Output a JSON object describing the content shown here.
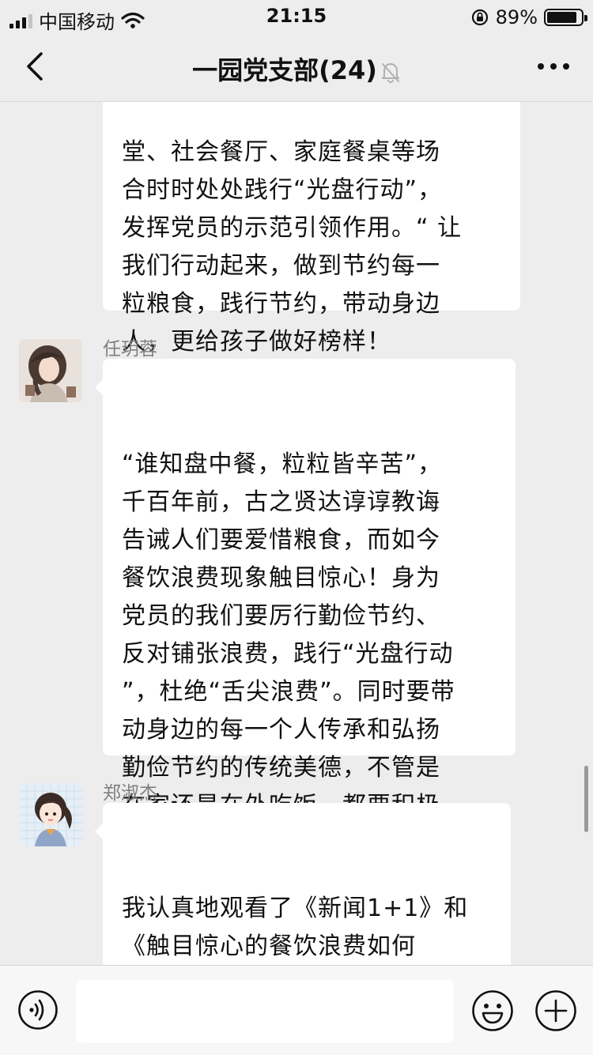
{
  "status_bar": {
    "carrier": "中国移动",
    "time": "21:15",
    "battery_percent_text": "89%",
    "battery_level": 0.89
  },
  "header": {
    "title": "一园党支部(24)"
  },
  "messages": [
    {
      "text": "堂、社会餐厅、家庭餐桌等场\n合时时处处践行“光盘行动”，\n发挥党员的示范引领作用。“ 让\n我们行动起来，做到节约每一\n粒粮食，践行节约，带动身边\n人，更给孩子做好榜样！"
    },
    {
      "sender": "任玥蓉",
      "text": "“谁知盘中餐，粒粒皆辛苦”，\n千百年前，古之贤达谆谆教诲\n告诫人们要爱惜粮食，而如今\n餐饮浪费现象触目惊心！身为\n党员的我们要厉行勤俭节约、\n反对铺张浪费，践行“光盘行动\n”，杜绝“舌尖浪费”。同时要带\n动身边的每一个人传承和弘扬\n勤俭节约的传统美德，不管是\n在家还是在外吃饭，都要积极\n做到厉行节约、反对浪费。"
    },
    {
      "sender": "郑淑杰",
      "text": "我认真地观看了《新闻1+1》和\n《触目惊心的餐饮浪费如何\n治》的访谈后感受到小小的餐\n桌，传承了我们祖先文明有\n礼，节俭惜福的优良传统，珍"
    }
  ],
  "input_bar": {
    "placeholder": ""
  }
}
